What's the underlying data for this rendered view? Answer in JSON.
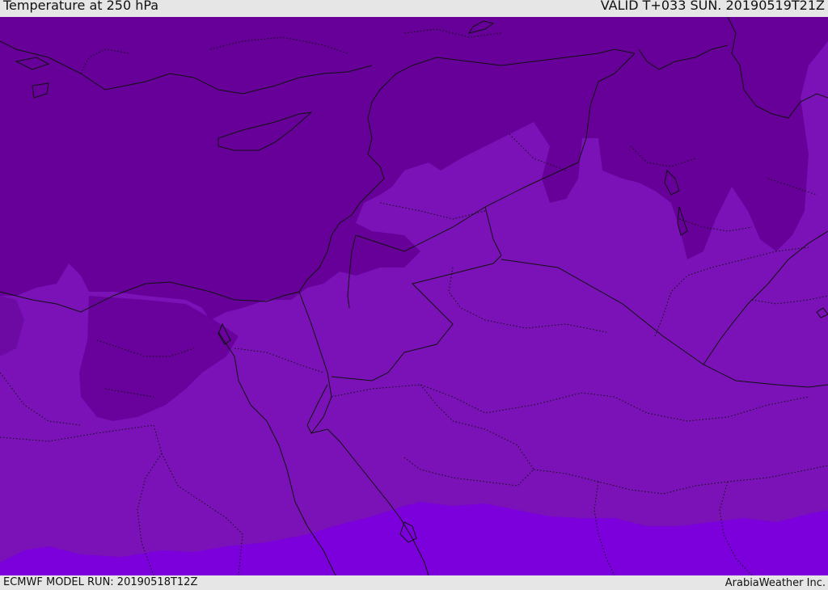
{
  "header": {
    "title": "Temperature at 250 hPa",
    "valid": "VALID T+033 SUN. 20190519T21Z"
  },
  "footer": {
    "model_run": "ECMWF MODEL RUN: 20190518T12Z",
    "credit": "ArabiaWeather Inc."
  },
  "map": {
    "colors": {
      "coldest": "#660099",
      "cold": "#7110ad",
      "mid": "#7a12b7",
      "warm": "#7b00db",
      "border": "#111111"
    }
  }
}
